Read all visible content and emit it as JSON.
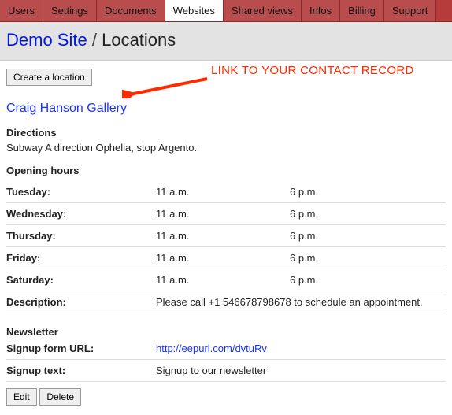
{
  "tabs": [
    "Users",
    "Settings",
    "Documents",
    "Websites",
    "Shared views",
    "Infos",
    "Billing",
    "Support"
  ],
  "active_tab_index": 3,
  "breadcrumb": {
    "site_link": "Demo Site",
    "sep": "/",
    "page": "Locations"
  },
  "buttons": {
    "create": "Create a location",
    "edit": "Edit",
    "delete": "Delete"
  },
  "annotation": "LINK TO YOUR CONTACT RECORD",
  "location": {
    "name": "Craig Hanson Gallery",
    "directions_label": "Directions",
    "directions": "Subway A direction Ophelia, stop Argento.",
    "opening_label": "Opening hours",
    "hours": [
      {
        "day": "Tuesday:",
        "open": "11 a.m.",
        "close": "6 p.m."
      },
      {
        "day": "Wednesday:",
        "open": "11 a.m.",
        "close": "6 p.m."
      },
      {
        "day": "Thursday:",
        "open": "11 a.m.",
        "close": "6 p.m."
      },
      {
        "day": "Friday:",
        "open": "11 a.m.",
        "close": "6 p.m."
      },
      {
        "day": "Saturday:",
        "open": "11 a.m.",
        "close": "6 p.m."
      }
    ],
    "description_label": "Description:",
    "description": "Please call +1 546678798678 to schedule an appointment.",
    "newsletter_label": "Newsletter",
    "signup_url_label": "Signup form URL:",
    "signup_url": "http://eepurl.com/dvtuRv",
    "signup_text_label": "Signup text:",
    "signup_text": "Signup to our newsletter"
  }
}
